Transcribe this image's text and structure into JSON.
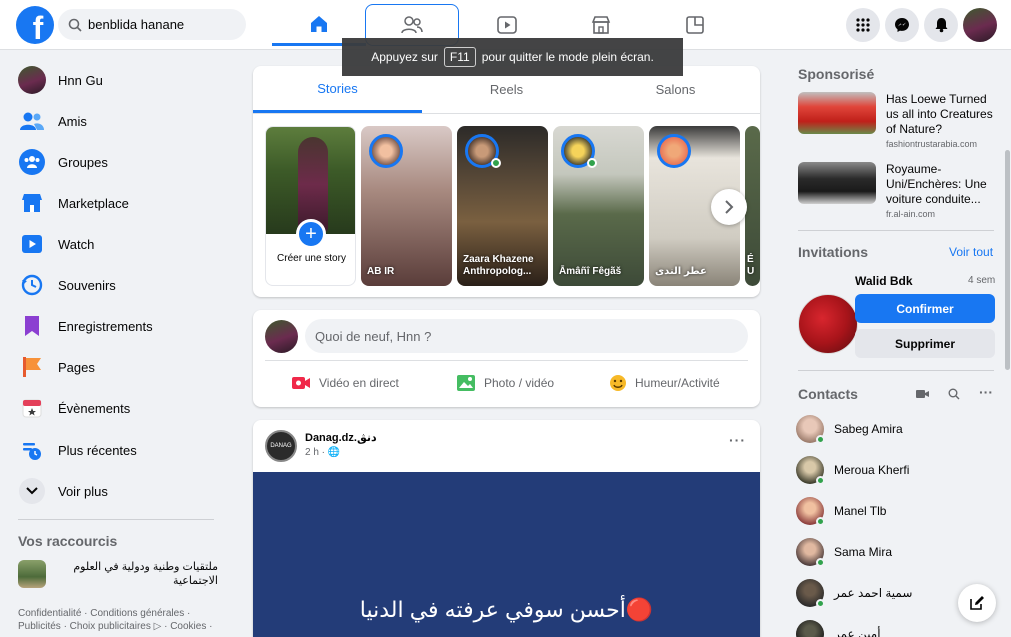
{
  "header": {
    "search_value": "benblida hanane",
    "nav_tabs": [
      "Accueil",
      "Amis",
      "Watch",
      "Marketplace",
      "Gaming"
    ],
    "fullscreen_toast": {
      "before": "Appuyez sur",
      "key": "F11",
      "after": "pour quitter le mode plein écran."
    }
  },
  "left_nav": {
    "items": [
      {
        "label": "Hnn Gu",
        "icon": "profile-avatar"
      },
      {
        "label": "Amis",
        "icon": "friends-icon"
      },
      {
        "label": "Groupes",
        "icon": "groups-icon"
      },
      {
        "label": "Marketplace",
        "icon": "marketplace-icon"
      },
      {
        "label": "Watch",
        "icon": "watch-icon"
      },
      {
        "label": "Souvenirs",
        "icon": "memories-icon"
      },
      {
        "label": "Enregistrements",
        "icon": "saved-icon"
      },
      {
        "label": "Pages",
        "icon": "pages-icon"
      },
      {
        "label": "Évènements",
        "icon": "events-icon"
      },
      {
        "label": "Plus récentes",
        "icon": "recent-icon"
      },
      {
        "label": "Voir plus",
        "icon": "chevron-down-icon"
      }
    ],
    "shortcuts_title": "Vos raccourcis",
    "shortcut_label": "ملتقيات وطنية ودولية في العلوم الاجتماعية",
    "footer": "Confidentialité · Conditions générales · Publicités · Choix publicitaires ▷ · Cookies ·"
  },
  "stories": {
    "tabs": [
      "Stories",
      "Reels",
      "Salons"
    ],
    "create_label": "Créer une story",
    "items": [
      {
        "name": "AB IR"
      },
      {
        "name": "Zaara Khazene Anthropolog..."
      },
      {
        "name": "Āmâñî Fêgãš"
      },
      {
        "name": "عطر الندى"
      },
      {
        "name": "É U"
      }
    ]
  },
  "composer": {
    "placeholder": "Quoi de neuf, Hnn ?",
    "actions": [
      "Vidéo en direct",
      "Photo / vidéo",
      "Humeur/Activité"
    ]
  },
  "post": {
    "author": "Danag.dz.دنڨ",
    "meta": "2 h · 🌐",
    "more": "···",
    "text_line1": "🔴أحسن سوفي عرفته في الدنيا",
    "text_line2": "... ...",
    "avatar_text": "DANAG"
  },
  "right_col": {
    "sponsored_title": "Sponsorisé",
    "ads": [
      {
        "title": "Has Loewe Turned us all into Creatures of Nature?",
        "domain": "fashiontrustarabia.com"
      },
      {
        "title": "Royaume-Uni/Enchères: Une voiture conduite...",
        "domain": "fr.al-ain.com"
      }
    ],
    "invitations_title": "Invitations",
    "see_all": "Voir tout",
    "invitation": {
      "name": "Walid Bdk",
      "time": "4 sem",
      "confirm": "Confirmer",
      "delete": "Supprimer"
    },
    "contacts_title": "Contacts",
    "contacts": [
      "Sabeg Amira",
      "Meroua Kherfi",
      "Manel Tlb",
      "Sama Mira",
      "سمية احمد عمر",
      "أمين عمر"
    ]
  },
  "colors": {
    "brand": "#1877f2",
    "bg": "#f0f2f5",
    "online": "#31a24c"
  }
}
